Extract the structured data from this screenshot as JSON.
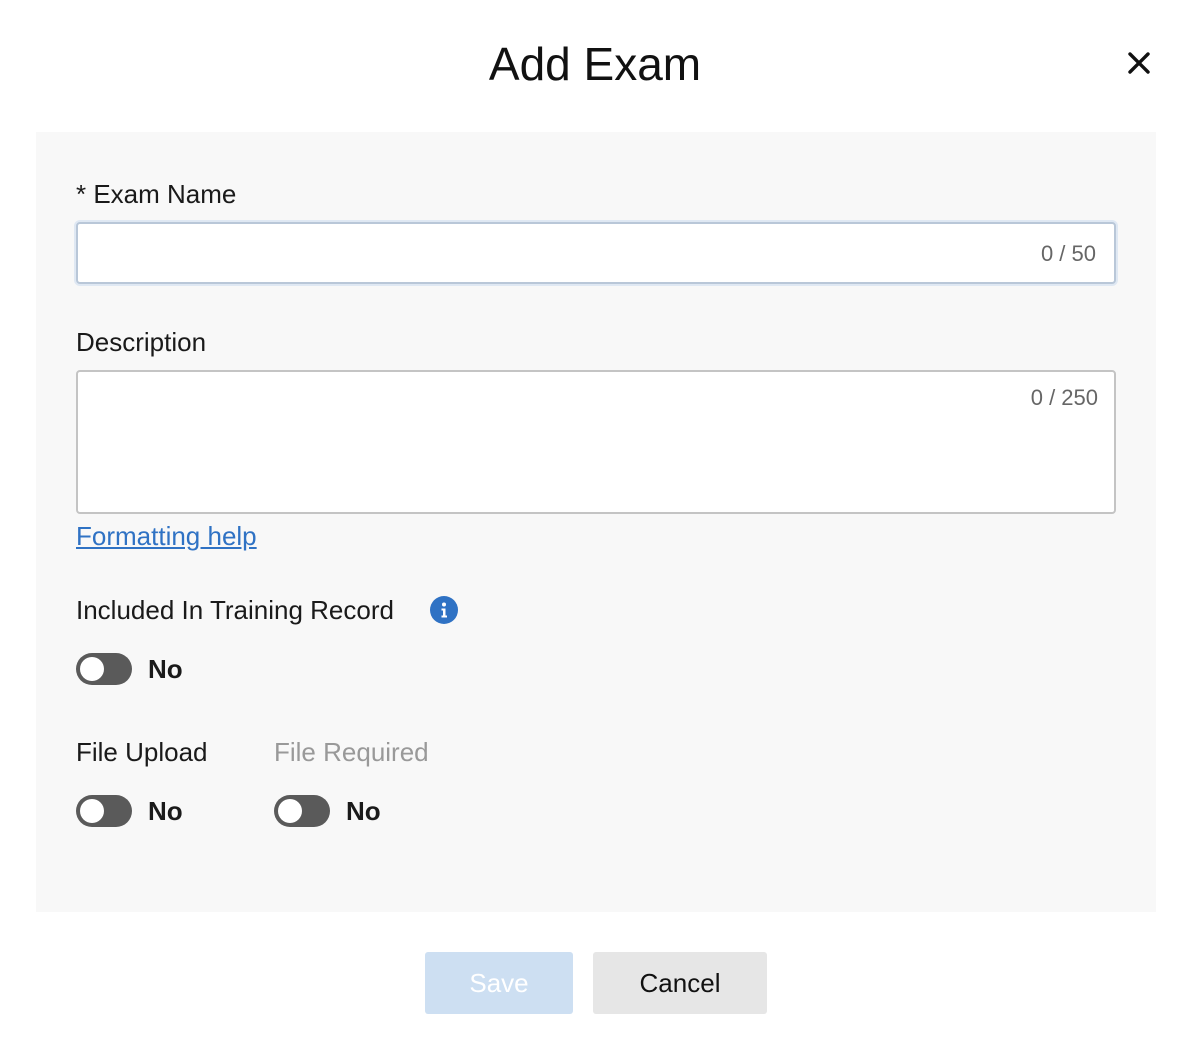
{
  "dialog": {
    "title": "Add Exam",
    "close_icon": "close-icon"
  },
  "form": {
    "exam_name": {
      "label": "* Exam Name",
      "value": "",
      "placeholder": "",
      "counter": "0 / 50"
    },
    "description": {
      "label": "Description",
      "value": "",
      "placeholder": "",
      "counter": "0 / 250"
    },
    "formatting_help": "Formatting help",
    "training_record": {
      "label": "Included In Training Record",
      "info_icon": "info-icon",
      "toggle_text": "No",
      "checked": false
    },
    "file_upload": {
      "label": "File Upload",
      "toggle_text": "No",
      "checked": false
    },
    "file_required": {
      "label": "File Required",
      "toggle_text": "No",
      "checked": false
    }
  },
  "footer": {
    "save_label": "Save",
    "cancel_label": "Cancel"
  },
  "colors": {
    "link": "#2f72c4",
    "info_icon": "#2f72c4",
    "save_disabled_bg": "#cddff2",
    "cancel_bg": "#e6e6e6",
    "toggle_off": "#5a5a5a",
    "panel_bg": "#f8f8f8"
  }
}
